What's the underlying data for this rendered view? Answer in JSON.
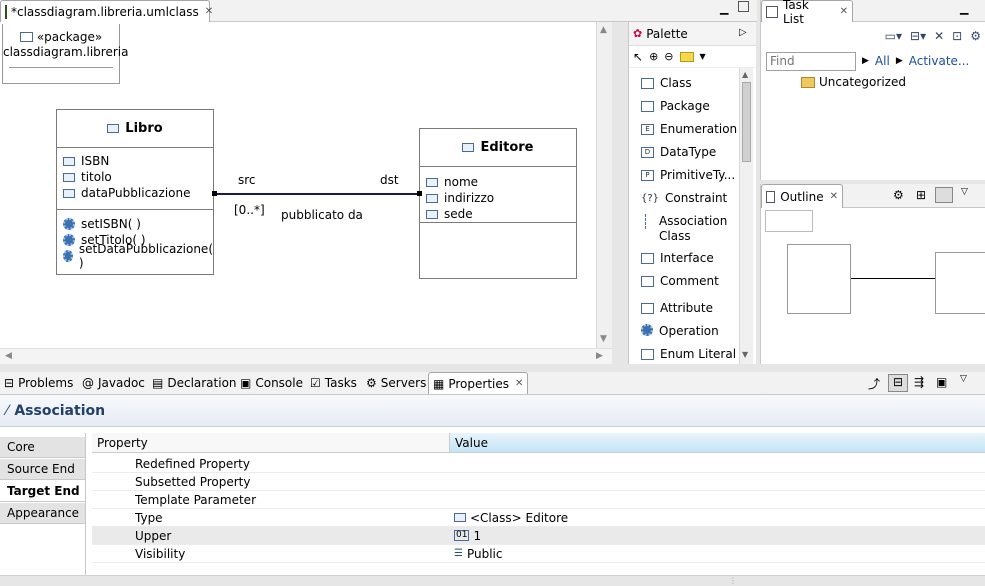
{
  "editor": {
    "tab_title": "*classdiagram.libreria.umlclass",
    "package_stereotype": "«package»",
    "package_name": "classdiagram.libreria"
  },
  "diagram": {
    "libro": {
      "name": "Libro",
      "attributes": [
        "ISBN",
        "titolo",
        "dataPubblicazione"
      ],
      "operations": [
        "setISBN( )",
        "setTitolo( )",
        "setDataPubblicazione( )"
      ]
    },
    "editore": {
      "name": "Editore",
      "attributes": [
        "nome",
        "indirizzo",
        "sede"
      ]
    },
    "association": {
      "src_label": "src",
      "dst_label": "dst",
      "multiplicity": "[0..*]",
      "name": "pubblicato da"
    }
  },
  "palette": {
    "title": "Palette",
    "items": [
      "Class",
      "Package",
      "Enumeration",
      "DataType",
      "PrimitiveTy...",
      "Constraint",
      "Association Class",
      "Interface",
      "Comment",
      "Attribute",
      "Operation",
      "Enum Literal"
    ]
  },
  "tasklist": {
    "title": "Task List",
    "find_placeholder": "Find",
    "all_label": "All",
    "activate_label": "Activate...",
    "category": "Uncategorized"
  },
  "outline": {
    "title": "Outline"
  },
  "bottom_tabs": [
    "Problems",
    "Javadoc",
    "Declaration",
    "Console",
    "Tasks",
    "Servers",
    "Properties"
  ],
  "properties": {
    "title": "Association",
    "left_tabs": [
      "Core",
      "Source End",
      "Target End",
      "Appearance"
    ],
    "selected_tab": "Target End",
    "col_property": "Property",
    "col_value": "Value",
    "rows": [
      {
        "property": "Redefined Property",
        "value": ""
      },
      {
        "property": "Subsetted Property",
        "value": ""
      },
      {
        "property": "Template Parameter",
        "value": ""
      },
      {
        "property": "Type",
        "value": "<Class> Editore"
      },
      {
        "property": "Upper",
        "value": "1"
      },
      {
        "property": "Visibility",
        "value": "Public"
      }
    ]
  }
}
